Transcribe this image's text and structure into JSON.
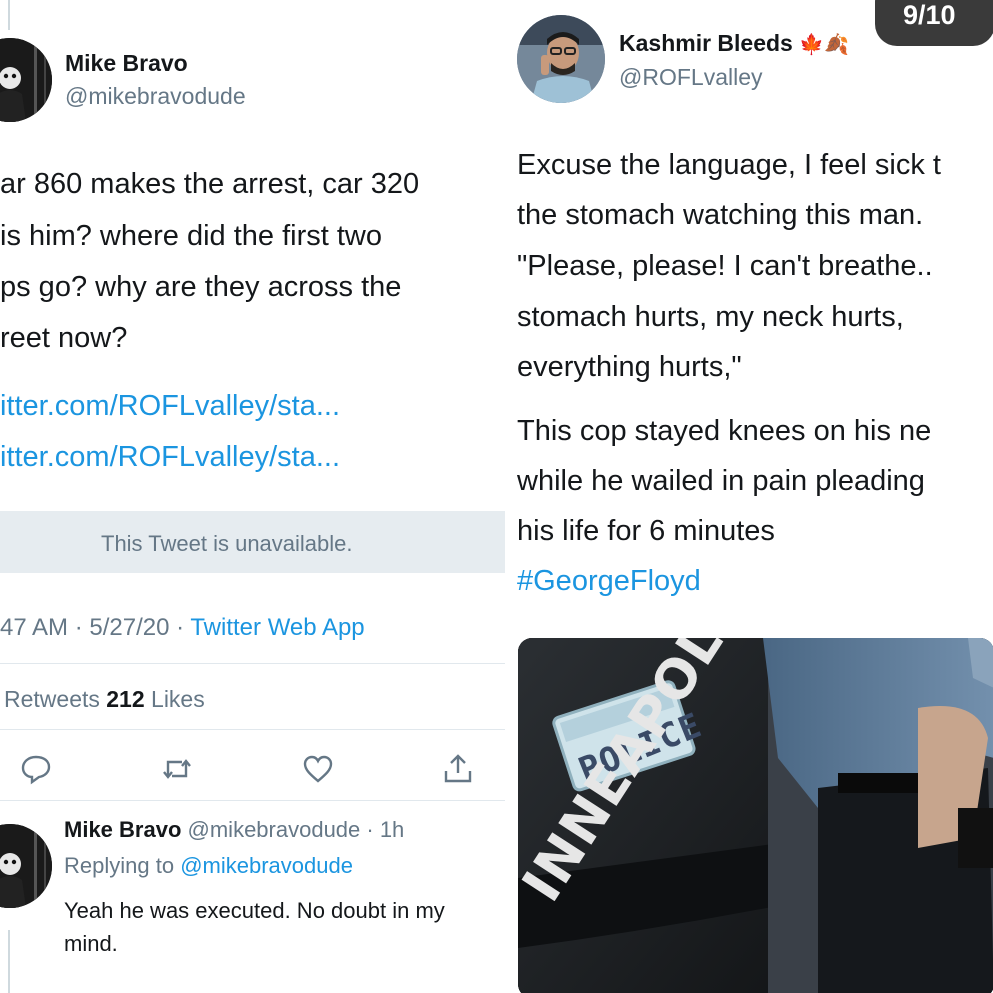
{
  "left_tweet": {
    "name": "Mike Bravo",
    "handle": "@mikebravodude",
    "body_lines": [
      "ar 860 makes the arrest, car 320",
      "is him? where did the first two",
      "ps go? why are they across the",
      "reet now?"
    ],
    "links": [
      "itter.com/ROFLvalley/sta...",
      "itter.com/ROFLvalley/sta..."
    ],
    "unavailable_text": "This Tweet is unavailable.",
    "meta_time": "47 AM · 5/27/20 · ",
    "meta_app": "Twitter Web App",
    "stats_retweets_label": "Retweets",
    "stats_likes_count": "212",
    "stats_likes_label": "Likes",
    "actions": [
      "reply-icon",
      "retweet-icon",
      "like-icon",
      "share-icon"
    ]
  },
  "reply_tweet": {
    "name": "Mike Bravo",
    "handle_time": "@mikebravodude · 1h",
    "replying_prefix": "Replying to ",
    "replying_handle": "@mikebravodude",
    "text_line1": "Yeah he was executed. No doubt in my",
    "text_line2": "mind."
  },
  "right_tweet": {
    "name": "Kashmir Bleeds",
    "name_emojis": "🍁🍂",
    "handle": "@ROFLvalley",
    "body_lines": [
      "Excuse the language, I feel sick t",
      "the stomach watching this man.",
      "\"Please, please! I can't breathe..",
      "stomach hurts, my neck hurts,",
      "everything hurts,\""
    ],
    "body_lines2": [
      "This cop stayed knees on his ne",
      "while he wailed in pain pleading",
      "his life for 6 minutes"
    ],
    "hashtag": "#GeorgeFloyd",
    "video_plate_text": "POLICE",
    "video_car_text": "INNEAPOLIS"
  },
  "page_counter": "9/10",
  "colors": {
    "link": "#1b95e0",
    "muted": "#657786",
    "text": "#14171a",
    "unavailable_bg": "#e6ecf0",
    "counter_bg": "#3a3a3a"
  }
}
